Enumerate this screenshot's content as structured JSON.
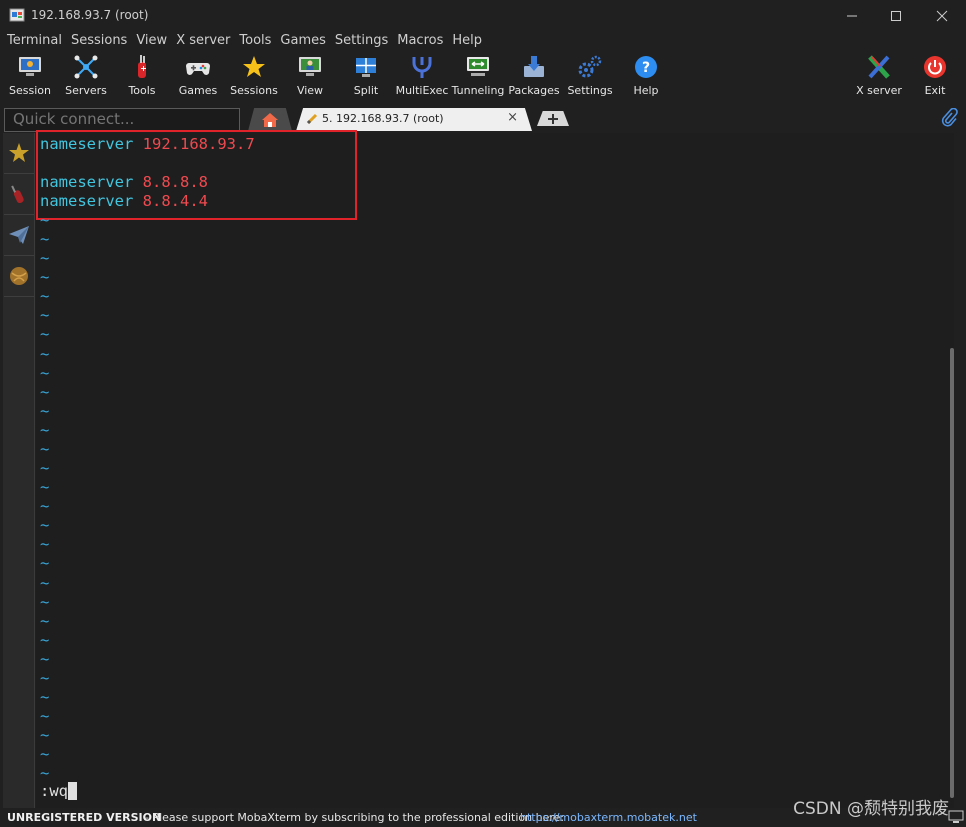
{
  "window": {
    "title": "192.168.93.7 (root)"
  },
  "menu": [
    "Terminal",
    "Sessions",
    "View",
    "X server",
    "Tools",
    "Games",
    "Settings",
    "Macros",
    "Help"
  ],
  "toolbar": {
    "session": "Session",
    "servers": "Servers",
    "tools": "Tools",
    "games": "Games",
    "sessions": "Sessions",
    "view": "View",
    "split": "Split",
    "multiexec": "MultiExec",
    "tunneling": "Tunneling",
    "packages": "Packages",
    "settings": "Settings",
    "help": "Help",
    "xserver": "X server",
    "exit": "Exit"
  },
  "quick_connect": {
    "placeholder": "Quick connect..."
  },
  "tabs": {
    "session_tab": "5. 192.168.93.7 (root)",
    "close": "×"
  },
  "terminal": {
    "lines": [
      {
        "keyword": "nameserver",
        "value": "192.168.93.7"
      },
      {
        "keyword": "",
        "value": ""
      },
      {
        "keyword": "nameserver",
        "value": "8.8.8.8"
      },
      {
        "keyword": "nameserver",
        "value": "8.8.4.4"
      }
    ],
    "tilde": "~",
    "command": ":wq"
  },
  "status": {
    "unregistered": "UNREGISTERED VERSION",
    "support": " -  Please support MobaXterm by subscribing to the professional edition here:",
    "link": "https://mobaxterm.mobatek.net"
  },
  "watermark": "CSDN @颓特别我废",
  "colors": {
    "keyword": "#41c6e0",
    "value": "#ee4a4f",
    "tilde": "#38a7d8",
    "highlight_box": "#e0222a"
  }
}
